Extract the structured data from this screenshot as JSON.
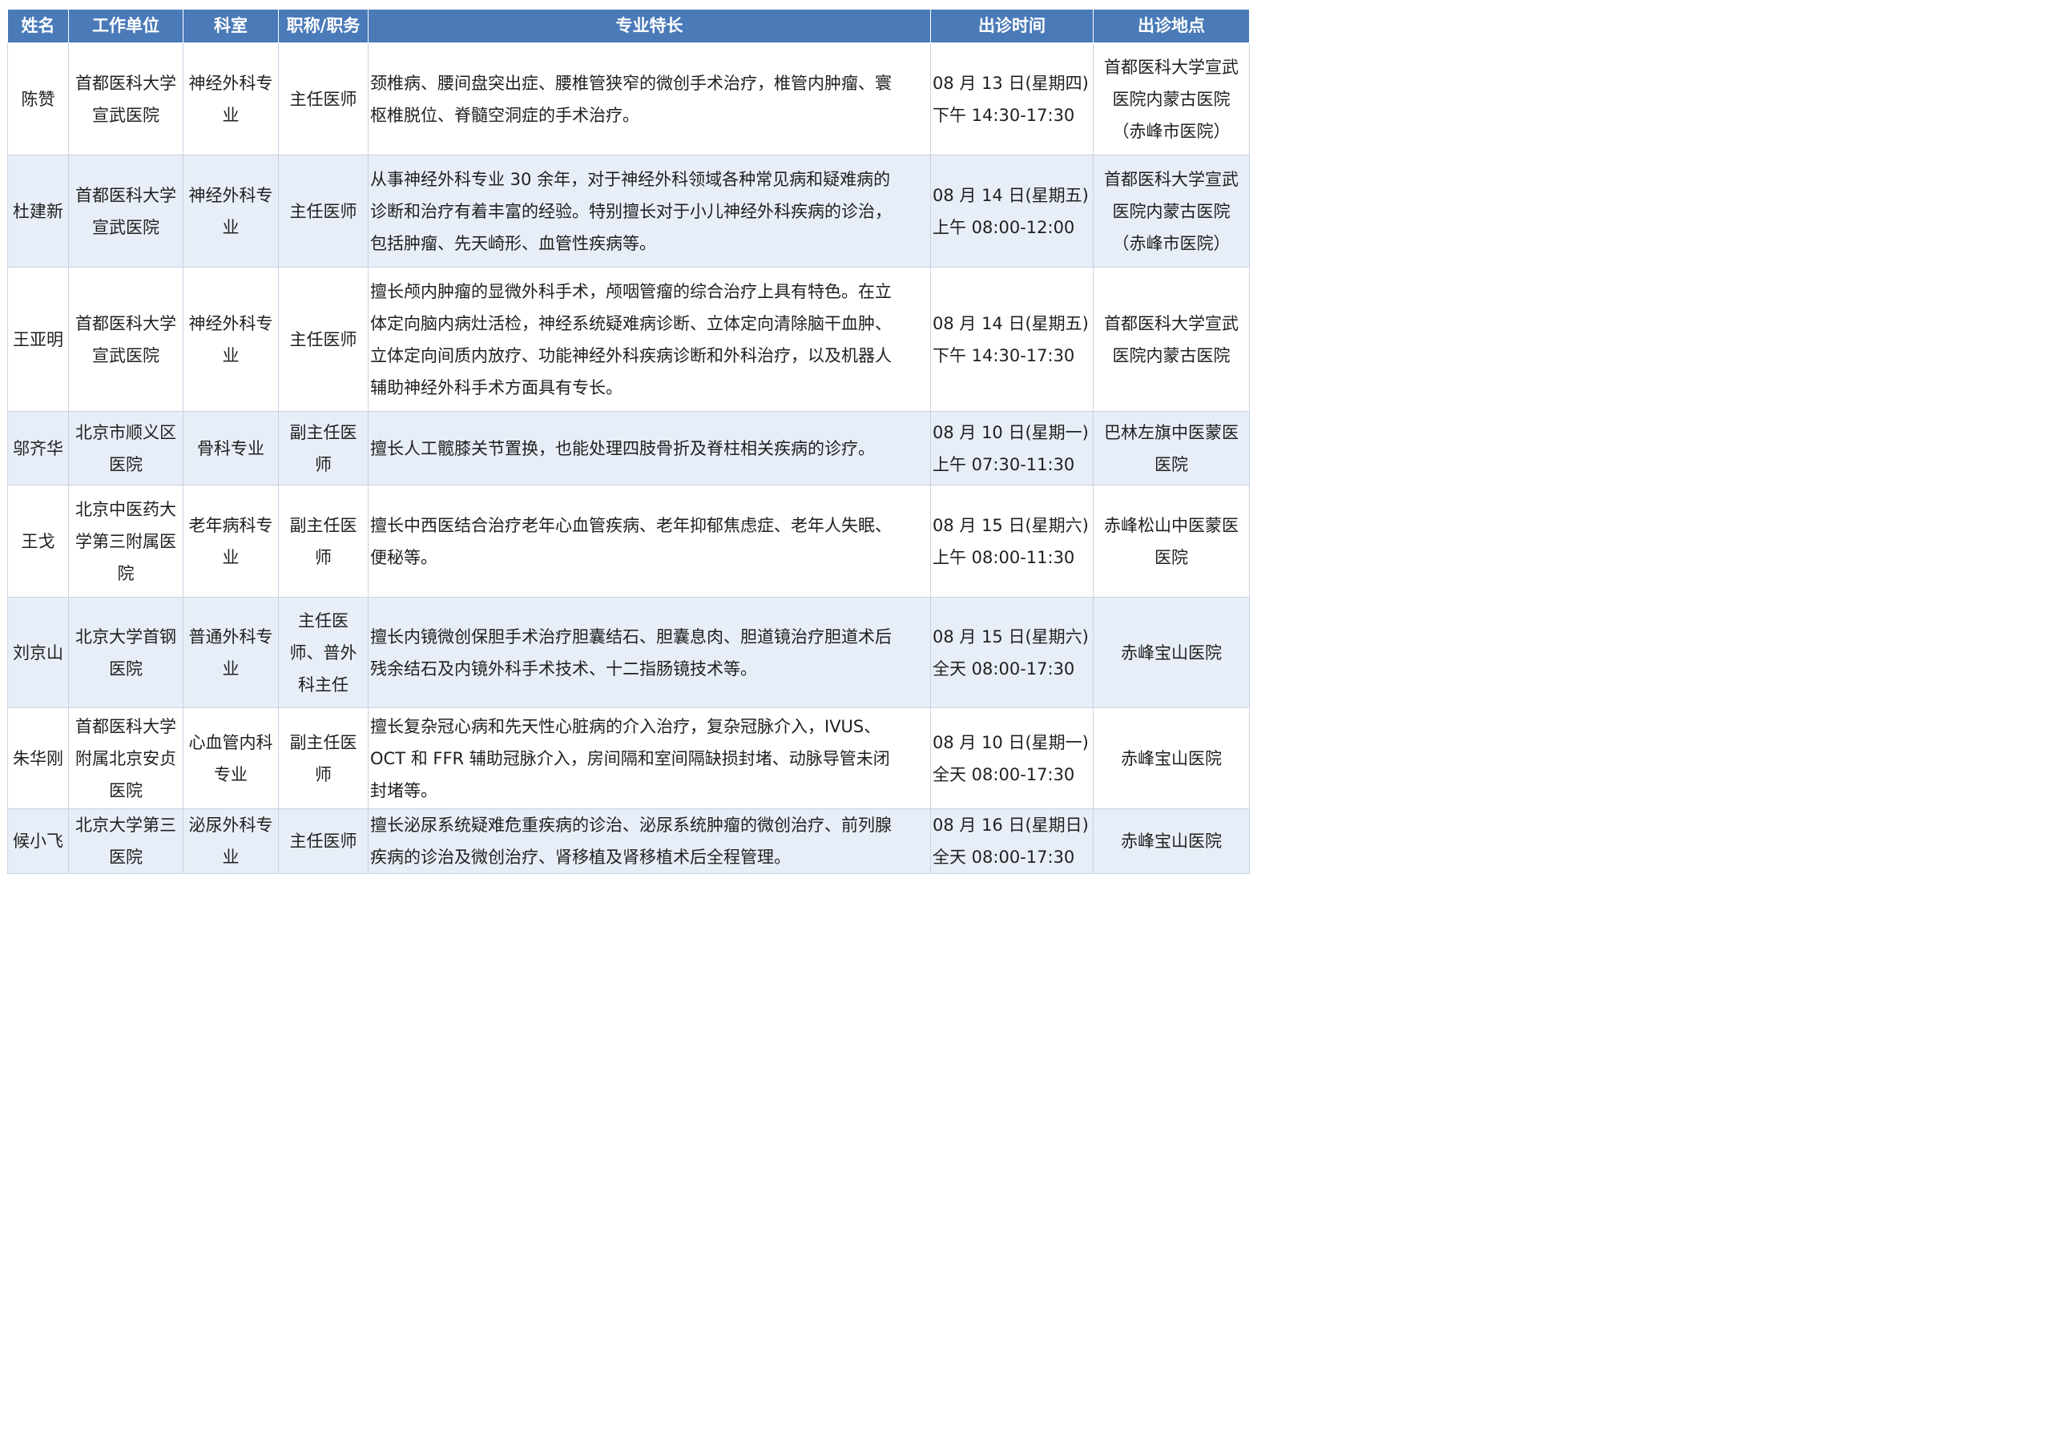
{
  "headers": [
    "姓名",
    "工作单位",
    "科室",
    "职称/职务",
    "专业特长",
    "出诊时间",
    "出诊地点"
  ],
  "rows": [
    {
      "name": "陈赞",
      "unit": [
        "首都医科大学",
        "宣武医院"
      ],
      "dept": [
        "神经外科专",
        "业"
      ],
      "title": [
        "主任医师"
      ],
      "spec": [
        "颈椎病、腰间盘突出症、腰椎管狭窄的微创手术治疗，椎管内肿瘤、寰",
        "枢椎脱位、脊髓空洞症的手术治疗。"
      ],
      "time": [
        "08 月 13 日(星期四)",
        "下午 14:30-17:30"
      ],
      "place": [
        "首都医科大学宣武",
        "医院内蒙古医院",
        "（赤峰市医院）"
      ]
    },
    {
      "name": "杜建新",
      "unit": [
        "首都医科大学",
        "宣武医院"
      ],
      "dept": [
        "神经外科专",
        "业"
      ],
      "title": [
        "主任医师"
      ],
      "spec": [
        "从事神经外科专业 30 余年，对于神经外科领域各种常见病和疑难病的",
        "诊断和治疗有着丰富的经验。特别擅长对于小儿神经外科疾病的诊治，",
        "包括肿瘤、先天崎形、血管性疾病等。"
      ],
      "time": [
        "08 月 14 日(星期五)",
        "上午 08:00-12:00"
      ],
      "place": [
        "首都医科大学宣武",
        "医院内蒙古医院",
        "（赤峰市医院）"
      ]
    },
    {
      "name": "王亚明",
      "unit": [
        "首都医科大学",
        "宣武医院"
      ],
      "dept": [
        "神经外科专",
        "业"
      ],
      "title": [
        "主任医师"
      ],
      "spec": [
        "擅长颅内肿瘤的显微外科手术，颅咽管瘤的综合治疗上具有特色。在立",
        "体定向脑内病灶活检，神经系统疑难病诊断、立体定向清除脑干血肿、",
        "立体定向间质内放疗、功能神经外科疾病诊断和外科治疗，以及机器人",
        "辅助神经外科手术方面具有专长。"
      ],
      "time": [
        "08 月 14 日(星期五)",
        "下午 14:30-17:30"
      ],
      "place": [
        "首都医科大学宣武",
        "医院内蒙古医院"
      ]
    },
    {
      "name": "邬齐华",
      "unit": [
        "北京市顺义区",
        "医院"
      ],
      "dept": [
        "骨科专业"
      ],
      "title": [
        "副主任医",
        "师"
      ],
      "spec": [
        "擅长人工髋膝关节置换，也能处理四肢骨折及脊柱相关疾病的诊疗。"
      ],
      "time": [
        "08 月 10 日(星期一)",
        "上午 07:30-11:30"
      ],
      "place": [
        "巴林左旗中医蒙医",
        "医院"
      ]
    },
    {
      "name": "王戈",
      "unit": [
        "北京中医药大",
        "学第三附属医",
        "院"
      ],
      "dept": [
        "老年病科专",
        "业"
      ],
      "title": [
        "副主任医",
        "师"
      ],
      "spec": [
        "擅长中西医结合治疗老年心血管疾病、老年抑郁焦虑症、老年人失眠、",
        "便秘等。"
      ],
      "time": [
        "08 月 15 日(星期六)",
        "上午 08:00-11:30"
      ],
      "place": [
        "赤峰松山中医蒙医",
        "医院"
      ]
    },
    {
      "name": "刘京山",
      "unit": [
        "北京大学首钢",
        "医院"
      ],
      "dept": [
        "普通外科专",
        "业"
      ],
      "title": [
        "主任医",
        "师、普外",
        "科主任"
      ],
      "spec": [
        "擅长内镜微创保胆手术治疗胆囊结石、胆囊息肉、胆道镜治疗胆道术后",
        "残余结石及内镜外科手术技术、十二指肠镜技术等。"
      ],
      "time": [
        "08 月 15 日(星期六)",
        "全天 08:00-17:30"
      ],
      "place": [
        "赤峰宝山医院"
      ]
    },
    {
      "name": "朱华刚",
      "unit": [
        "首都医科大学",
        "附属北京安贞",
        "医院"
      ],
      "dept": [
        "心血管内科",
        "专业"
      ],
      "title": [
        "副主任医",
        "师"
      ],
      "spec": [
        "擅长复杂冠心病和先天性心脏病的介入治疗，复杂冠脉介入，IVUS、",
        "OCT 和 FFR 辅助冠脉介入，房间隔和室间隔缺损封堵、动脉导管未闭",
        "封堵等。"
      ],
      "time": [
        "08 月 10 日(星期一)",
        "全天 08:00-17:30"
      ],
      "place": [
        "赤峰宝山医院"
      ]
    },
    {
      "name": "候小飞",
      "unit": [
        "北京大学第三",
        "医院"
      ],
      "dept": [
        "泌尿外科专",
        "业"
      ],
      "title": [
        "主任医师"
      ],
      "spec": [
        "擅长泌尿系统疑难危重疾病的诊治、泌尿系统肿瘤的微创治疗、前列腺",
        "疾病的诊治及微创治疗、肾移植及肾移植术后全程管理。"
      ],
      "time": [
        "08 月 16 日(星期日)",
        "全天 08:00-17:30"
      ],
      "place": [
        "赤峰宝山医院"
      ]
    }
  ]
}
